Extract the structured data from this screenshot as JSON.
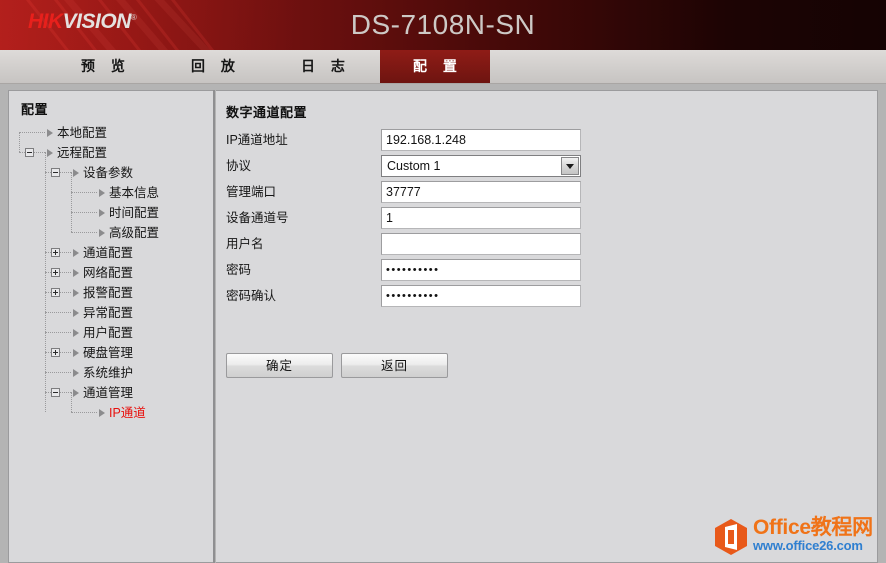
{
  "header": {
    "logo_hik": "HIK",
    "logo_vision": "VISION",
    "logo_tm": "®",
    "model": "DS-7108N-SN",
    "brand_red": "#e8201c",
    "bar_dark_red": "#7d1813"
  },
  "tabs": [
    {
      "label": "预 览",
      "name": "tab-preview",
      "active": false
    },
    {
      "label": "回 放",
      "name": "tab-playback",
      "active": false
    },
    {
      "label": "日 志",
      "name": "tab-log",
      "active": false
    },
    {
      "label": "配 置",
      "name": "tab-config",
      "active": true
    }
  ],
  "sidebar": {
    "title": "配置",
    "selected_color": "#e8100d",
    "items": [
      {
        "label": "本地配置",
        "level": 1,
        "expander": "none",
        "selected": false
      },
      {
        "label": "远程配置",
        "level": 1,
        "expander": "minus",
        "selected": false
      },
      {
        "label": "设备参数",
        "level": 2,
        "expander": "minus",
        "selected": false
      },
      {
        "label": "基本信息",
        "level": 3,
        "expander": "none",
        "selected": false
      },
      {
        "label": "时间配置",
        "level": 3,
        "expander": "none",
        "selected": false
      },
      {
        "label": "高级配置",
        "level": 3,
        "expander": "none",
        "selected": false
      },
      {
        "label": "通道配置",
        "level": 2,
        "expander": "plus",
        "selected": false
      },
      {
        "label": "网络配置",
        "level": 2,
        "expander": "plus",
        "selected": false
      },
      {
        "label": "报警配置",
        "level": 2,
        "expander": "plus",
        "selected": false
      },
      {
        "label": "异常配置",
        "level": 2,
        "expander": "none",
        "selected": false
      },
      {
        "label": "用户配置",
        "level": 2,
        "expander": "none",
        "selected": false
      },
      {
        "label": "硬盘管理",
        "level": 2,
        "expander": "plus",
        "selected": false
      },
      {
        "label": "系统维护",
        "level": 2,
        "expander": "none",
        "selected": false
      },
      {
        "label": "通道管理",
        "level": 2,
        "expander": "minus",
        "selected": false
      },
      {
        "label": "IP通道",
        "level": 3,
        "expander": "none",
        "selected": true
      }
    ]
  },
  "form": {
    "title": "数字通道配置",
    "fields": [
      {
        "label": "IP通道地址",
        "type": "text",
        "value": "192.168.1.248",
        "placeholder": ""
      },
      {
        "label": "协议",
        "type": "select",
        "value": "Custom 1",
        "placeholder": ""
      },
      {
        "label": "管理端口",
        "type": "text",
        "value": "37777",
        "placeholder": ""
      },
      {
        "label": "设备通道号",
        "type": "text",
        "value": "1",
        "placeholder": ""
      },
      {
        "label": "用户名",
        "type": "text",
        "value": "",
        "placeholder": ""
      },
      {
        "label": "密码",
        "type": "password",
        "value": "••••••••••",
        "placeholder": ""
      },
      {
        "label": "密码确认",
        "type": "password",
        "value": "••••••••••",
        "placeholder": ""
      }
    ],
    "buttons": {
      "ok": "确定",
      "back": "返回"
    }
  },
  "watermark": {
    "title": "Office教程网",
    "url": "www.office26.com",
    "title_color": "#f07318",
    "url_color": "#2f7fd0",
    "logo_name": "office-hexagon-icon"
  }
}
